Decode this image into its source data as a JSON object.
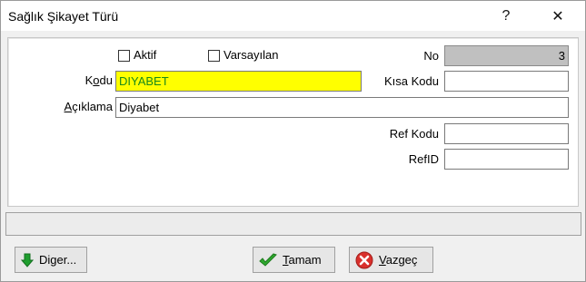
{
  "window": {
    "title": "Sağlık Şikayet Türü",
    "help_glyph": "?",
    "close_glyph": "✕"
  },
  "form": {
    "aktif_label": "Aktif",
    "varsayilan_label": "Varsayılan",
    "no_label": "No",
    "no_value": "3",
    "kodu_label": "Kodu",
    "kodu_value": "DIYABET",
    "kodu_bg": "#ffff00",
    "kisa_kodu_label": "Kısa Kodu",
    "aciklama_label": "Açıklama",
    "aciklama_value": "Diyabet",
    "ref_kodu_label": "Ref Kodu",
    "refid_label": "RefID"
  },
  "buttons": {
    "diger": "Diger...",
    "tamam": "Tamam",
    "vazgec": "Vazgeç"
  },
  "colors": {
    "check_green": "#2fa82f",
    "cancel_red": "#d9302c",
    "arrow_green": "#1e9e2e"
  }
}
